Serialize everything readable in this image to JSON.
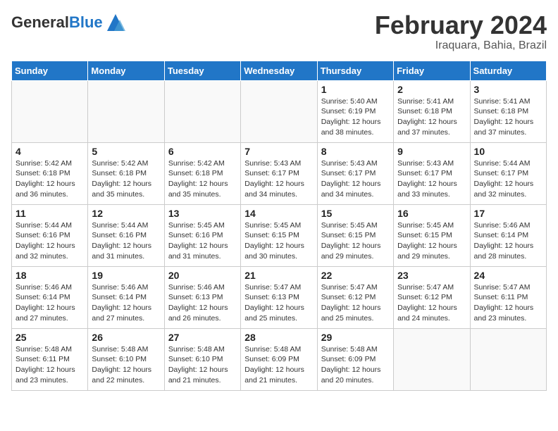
{
  "header": {
    "logo_general": "General",
    "logo_blue": "Blue",
    "month_title": "February 2024",
    "location": "Iraquara, Bahia, Brazil"
  },
  "days_of_week": [
    "Sunday",
    "Monday",
    "Tuesday",
    "Wednesday",
    "Thursday",
    "Friday",
    "Saturday"
  ],
  "weeks": [
    [
      {
        "day": "",
        "info": ""
      },
      {
        "day": "",
        "info": ""
      },
      {
        "day": "",
        "info": ""
      },
      {
        "day": "",
        "info": ""
      },
      {
        "day": "1",
        "info": "Sunrise: 5:40 AM\nSunset: 6:19 PM\nDaylight: 12 hours\nand 38 minutes."
      },
      {
        "day": "2",
        "info": "Sunrise: 5:41 AM\nSunset: 6:18 PM\nDaylight: 12 hours\nand 37 minutes."
      },
      {
        "day": "3",
        "info": "Sunrise: 5:41 AM\nSunset: 6:18 PM\nDaylight: 12 hours\nand 37 minutes."
      }
    ],
    [
      {
        "day": "4",
        "info": "Sunrise: 5:42 AM\nSunset: 6:18 PM\nDaylight: 12 hours\nand 36 minutes."
      },
      {
        "day": "5",
        "info": "Sunrise: 5:42 AM\nSunset: 6:18 PM\nDaylight: 12 hours\nand 35 minutes."
      },
      {
        "day": "6",
        "info": "Sunrise: 5:42 AM\nSunset: 6:18 PM\nDaylight: 12 hours\nand 35 minutes."
      },
      {
        "day": "7",
        "info": "Sunrise: 5:43 AM\nSunset: 6:17 PM\nDaylight: 12 hours\nand 34 minutes."
      },
      {
        "day": "8",
        "info": "Sunrise: 5:43 AM\nSunset: 6:17 PM\nDaylight: 12 hours\nand 34 minutes."
      },
      {
        "day": "9",
        "info": "Sunrise: 5:43 AM\nSunset: 6:17 PM\nDaylight: 12 hours\nand 33 minutes."
      },
      {
        "day": "10",
        "info": "Sunrise: 5:44 AM\nSunset: 6:17 PM\nDaylight: 12 hours\nand 32 minutes."
      }
    ],
    [
      {
        "day": "11",
        "info": "Sunrise: 5:44 AM\nSunset: 6:16 PM\nDaylight: 12 hours\nand 32 minutes."
      },
      {
        "day": "12",
        "info": "Sunrise: 5:44 AM\nSunset: 6:16 PM\nDaylight: 12 hours\nand 31 minutes."
      },
      {
        "day": "13",
        "info": "Sunrise: 5:45 AM\nSunset: 6:16 PM\nDaylight: 12 hours\nand 31 minutes."
      },
      {
        "day": "14",
        "info": "Sunrise: 5:45 AM\nSunset: 6:15 PM\nDaylight: 12 hours\nand 30 minutes."
      },
      {
        "day": "15",
        "info": "Sunrise: 5:45 AM\nSunset: 6:15 PM\nDaylight: 12 hours\nand 29 minutes."
      },
      {
        "day": "16",
        "info": "Sunrise: 5:45 AM\nSunset: 6:15 PM\nDaylight: 12 hours\nand 29 minutes."
      },
      {
        "day": "17",
        "info": "Sunrise: 5:46 AM\nSunset: 6:14 PM\nDaylight: 12 hours\nand 28 minutes."
      }
    ],
    [
      {
        "day": "18",
        "info": "Sunrise: 5:46 AM\nSunset: 6:14 PM\nDaylight: 12 hours\nand 27 minutes."
      },
      {
        "day": "19",
        "info": "Sunrise: 5:46 AM\nSunset: 6:14 PM\nDaylight: 12 hours\nand 27 minutes."
      },
      {
        "day": "20",
        "info": "Sunrise: 5:46 AM\nSunset: 6:13 PM\nDaylight: 12 hours\nand 26 minutes."
      },
      {
        "day": "21",
        "info": "Sunrise: 5:47 AM\nSunset: 6:13 PM\nDaylight: 12 hours\nand 25 minutes."
      },
      {
        "day": "22",
        "info": "Sunrise: 5:47 AM\nSunset: 6:12 PM\nDaylight: 12 hours\nand 25 minutes."
      },
      {
        "day": "23",
        "info": "Sunrise: 5:47 AM\nSunset: 6:12 PM\nDaylight: 12 hours\nand 24 minutes."
      },
      {
        "day": "24",
        "info": "Sunrise: 5:47 AM\nSunset: 6:11 PM\nDaylight: 12 hours\nand 23 minutes."
      }
    ],
    [
      {
        "day": "25",
        "info": "Sunrise: 5:48 AM\nSunset: 6:11 PM\nDaylight: 12 hours\nand 23 minutes."
      },
      {
        "day": "26",
        "info": "Sunrise: 5:48 AM\nSunset: 6:10 PM\nDaylight: 12 hours\nand 22 minutes."
      },
      {
        "day": "27",
        "info": "Sunrise: 5:48 AM\nSunset: 6:10 PM\nDaylight: 12 hours\nand 21 minutes."
      },
      {
        "day": "28",
        "info": "Sunrise: 5:48 AM\nSunset: 6:09 PM\nDaylight: 12 hours\nand 21 minutes."
      },
      {
        "day": "29",
        "info": "Sunrise: 5:48 AM\nSunset: 6:09 PM\nDaylight: 12 hours\nand 20 minutes."
      },
      {
        "day": "",
        "info": ""
      },
      {
        "day": "",
        "info": ""
      }
    ]
  ]
}
